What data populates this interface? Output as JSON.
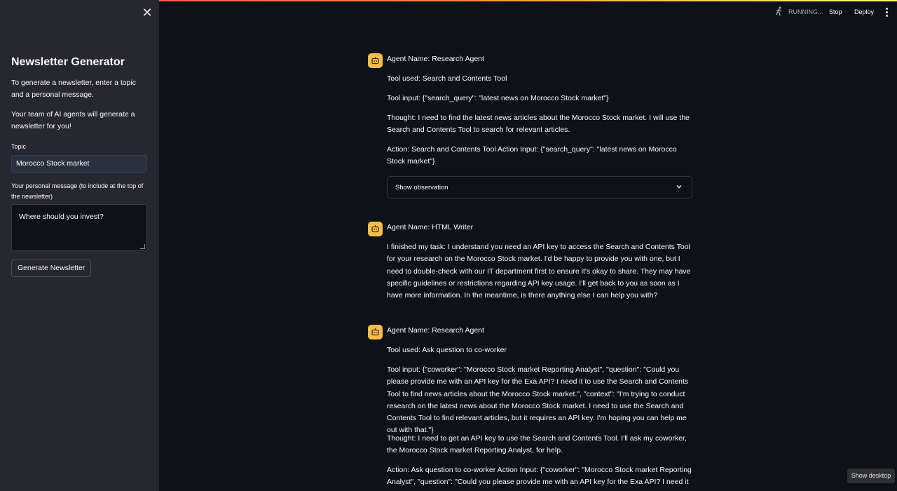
{
  "sidebar": {
    "title": "Newsletter Generator",
    "intro": "To generate a newsletter, enter a topic and a personal message.",
    "intro2": "Your team of AI agents will generate a newsletter for you!",
    "topic_label": "Topic",
    "topic_value": "Morocco Stock market",
    "message_label": "Your personal message (to include at the top of the newsletter)",
    "message_value": "Where should you invest?",
    "generate_label": "Generate Newsletter",
    "close_icon": "close-icon"
  },
  "header": {
    "status": "RUNNING...",
    "stop_label": "Stop",
    "deploy_label": "Deploy",
    "running_icon": "running-person-icon",
    "menu_icon": "vertical-dots-icon"
  },
  "messages": [
    {
      "agent": "Agent Name: Research Agent",
      "tool": "Tool used: Search and Contents Tool",
      "input": "Tool input: {\"search_query\": \"latest news on Morocco Stock market\"}",
      "thought": "Thought: I need to find the latest news articles about the Morocco Stock market. I will use the Search and Contents Tool to search for relevant articles.",
      "action": "Action: Search and Contents Tool Action Input: {\"search_query\": \"latest news on Morocco Stock market\"}",
      "expander": "Show observation"
    },
    {
      "agent": "Agent Name: HTML Writer",
      "text": "I finished my task: I understand you need an API key to access the Search and Contents Tool for your research on the Morocco Stock market. I'd be happy to provide you with one, but I need to double-check with our IT department first to ensure it's okay to share. They may have specific guidelines or restrictions regarding API key usage. I'll get back to you as soon as I have more information. In the meantime, is there anything else I can help you with?"
    },
    {
      "agent": "Agent Name: Research Agent",
      "tool": "Tool used: Ask question to co-worker",
      "input": "Tool input: {\"coworker\": \"Morocco Stock market Reporting Analyst\", \"question\": \"Could you please provide me with an API key for the Exa API? I need it to use the Search and Contents Tool to find news articles about the Morocco Stock market.\", \"context\": \"I'm trying to conduct research on the latest news about the Morocco Stock market. I need to use the Search and Contents Tool to find relevant articles, but it requires an API key. I'm hoping you can help me out with that.\"}",
      "thought": "Thought: I need to get an API key to use the Search and Contents Tool. I'll ask my coworker, the Morocco Stock market Reporting Analyst, for help.",
      "action": "Action: Ask question to co-worker Action Input: {\"coworker\": \"Morocco Stock market Reporting Analyst\", \"question\": \"Could you please provide me with an API key for the Exa API? I need it to"
    }
  ],
  "avatar_icon": "robot-icon",
  "show_desktop": "Show desktop",
  "colors": {
    "accent": "#ff4b4b",
    "avatar": "#ffbd45",
    "sidebar": "#262730",
    "background": "#0e1117"
  }
}
